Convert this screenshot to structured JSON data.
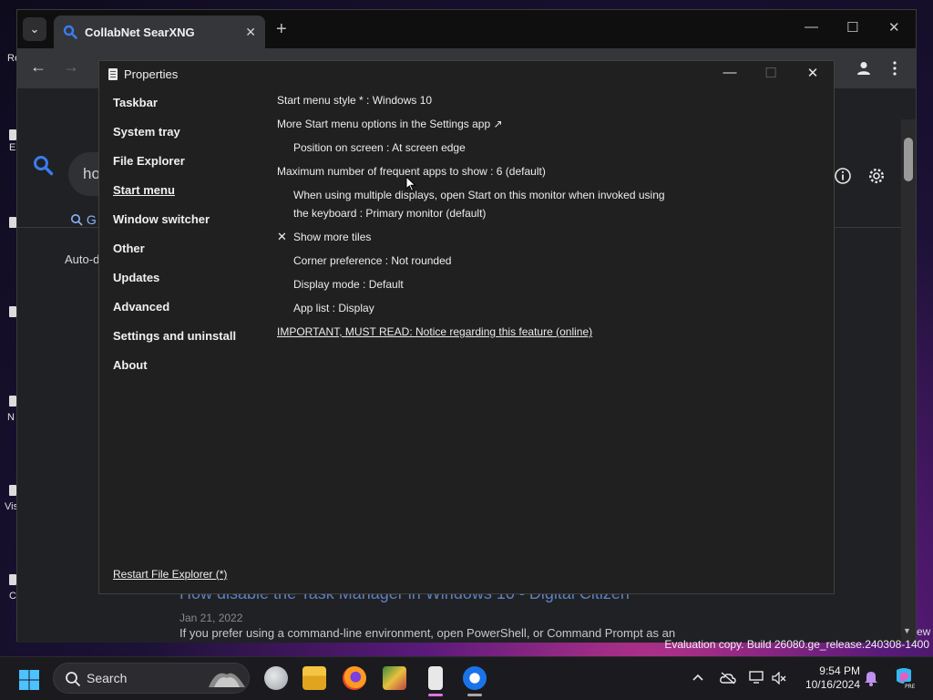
{
  "desktop": {
    "labels": [
      "Re",
      "E",
      "N",
      "Vis",
      "C"
    ]
  },
  "browser": {
    "tab_title": "CollabNet SearXNG",
    "tab_close": "✕",
    "new_tab": "+",
    "tab_dropdown": "⌄",
    "min": "—",
    "max": "☐",
    "close": "✕",
    "back": "←",
    "forward": "→",
    "search_query_partial": "ho",
    "tab_general_partial": "G",
    "autod_partial": "Auto-d",
    "result_title": "How disable the Task Manager in Windows 10 - Digital Citizen",
    "result_date": "Jan 21, 2022",
    "result_snippet": "If you prefer using a command-line environment, open PowerShell, or Command Prompt as an"
  },
  "properties": {
    "title": "Properties",
    "min": "—",
    "max": "☐",
    "close": "✕",
    "nav": [
      {
        "label": "Taskbar"
      },
      {
        "label": "System tray"
      },
      {
        "label": "File Explorer"
      },
      {
        "label": "Start menu"
      },
      {
        "label": "Window switcher"
      },
      {
        "label": "Other"
      },
      {
        "label": "Updates"
      },
      {
        "label": "Advanced"
      },
      {
        "label": "Settings and uninstall"
      },
      {
        "label": "About"
      }
    ],
    "restart_link": "Restart File Explorer (*)",
    "options": {
      "start_menu_style": "Start menu style * : Windows 10",
      "more_options": "More Start menu options in the Settings app ↗",
      "position": "Position on screen : At screen edge",
      "max_frequent": "Maximum number of frequent apps to show : 6 (default)",
      "multi_display_1": "When using multiple displays, open Start on this monitor when invoked using",
      "multi_display_2": "the keyboard : Primary monitor (default)",
      "show_more_tiles_mark": "✕",
      "show_more_tiles": "Show more tiles",
      "corner_pref": "Corner preference : Not rounded",
      "display_mode": "Display mode : Default",
      "app_list": "App list : Display",
      "important_link": "IMPORTANT, MUST READ: Notice regarding this feature (online)"
    }
  },
  "watermark": {
    "text": "Evaluation copy. Build 26080.ge_release.240308-1400",
    "partial": "ew"
  },
  "taskbar": {
    "search_label": "Search",
    "time": "9:54 PM",
    "date": "10/16/2024",
    "tray_chevron": "^"
  }
}
